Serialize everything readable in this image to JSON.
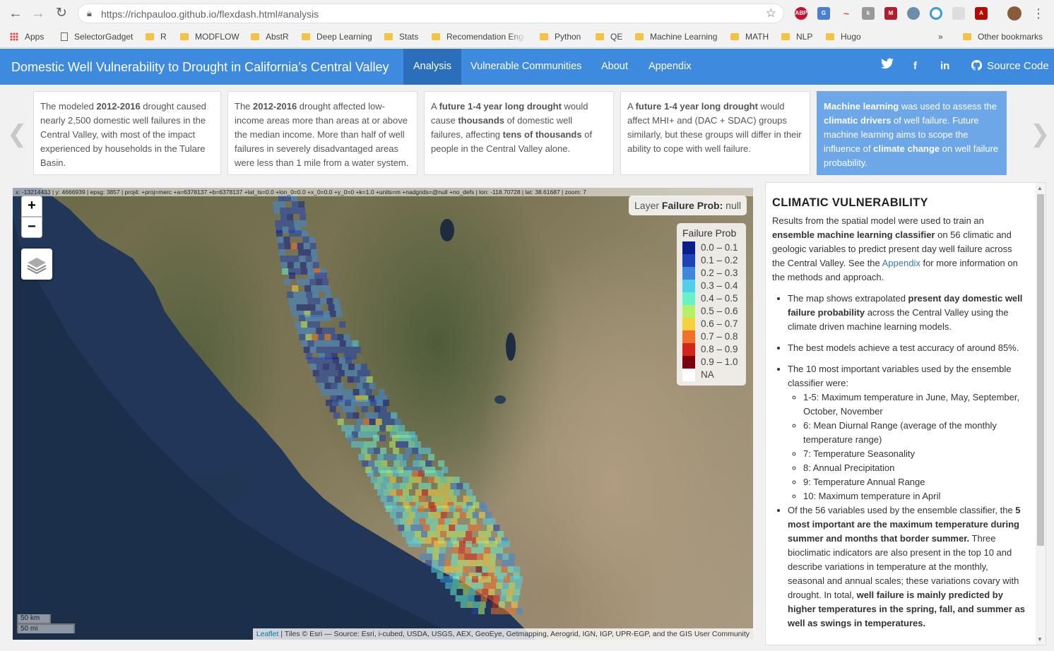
{
  "browser": {
    "url": "https://richpauloo.github.io/flexdash.html#analysis",
    "extensions": [
      "ABP",
      "G",
      "~",
      "k",
      "M",
      "",
      "",
      "",
      "A",
      ""
    ],
    "bookmarks": [
      "Apps",
      "SelectorGadget",
      "R",
      "MODFLOW",
      "AbstR",
      "Deep Learning",
      "Stats",
      "Recomendation Engi",
      "Python",
      "QE",
      "Machine Learning",
      "MATH",
      "NLP",
      "Hugo"
    ],
    "overflow": "»",
    "other_bookmarks": "Other bookmarks"
  },
  "navbar": {
    "title": "Domestic Well Vulnerability to Drought in California’s Central Valley",
    "tabs": [
      "Analysis",
      "Vulnerable Communities",
      "About",
      "Appendix"
    ],
    "active_tab": "Analysis",
    "source_code": "Source Code",
    "colors": {
      "bar": "#3e8ade",
      "active": "#2a6ebc"
    }
  },
  "valueboxes": [
    {
      "pre": "The modeled ",
      "bold": "2012-2016",
      "post": " drought caused nearly 2,500 domestic well failures in the Central Valley, with most of the impact experienced by households in the Tulare Basin."
    },
    {
      "pre": "The ",
      "bold": "2012-2016",
      "post": " drought affected low-income areas more than areas at or above the median income. More than half of well failures in severely disadvantaged areas were less than 1 mile from a water system."
    },
    {
      "p1": "A ",
      "b1": "future 1-4 year long drought",
      "p2": " would cause ",
      "b2": "thousands",
      "p3": " of domestic well failures, affecting ",
      "b3": "tens of thousands",
      "p4": " of people in the Central Valley alone."
    },
    {
      "p1": "A ",
      "b1": "future 1-4 year long drought",
      "p2": " would affect MHI+ and (DAC + SDAC) groups similarly, but these groups will differ in their ability to cope with well failure."
    },
    {
      "b1": "Machine learning",
      "p1": " was used to assess the ",
      "b2": "climatic drivers",
      "p2": " of well failure. Future machine learning aims to scope the influence of ",
      "b3": "climate change",
      "p3": " on well failure probability."
    }
  ],
  "map": {
    "coords": "x: -13214433 | y: 4666939 | epsg: 3857 | proj4: +proj=merc +a=6378137 +b=6378137 +lat_ts=0.0 +lon_0=0.0 +x_0=0.0 +y_0=0 +k=1.0 +units=m +nadgrids=@null +no_defs | lon: -118.70728 | lat: 38.61687 | zoom: 7",
    "zoom_in": "+",
    "zoom_out": "−",
    "layer_label": "Layer",
    "layer_name": "Failure Prob:",
    "layer_value": "null",
    "legend_title": "Failure Prob",
    "legend": [
      {
        "label": "0.0 – 0.1",
        "color": "#0a1e8c"
      },
      {
        "label": "0.1 – 0.2",
        "color": "#1d44b5"
      },
      {
        "label": "0.2 – 0.3",
        "color": "#3d88d8"
      },
      {
        "label": "0.3 – 0.4",
        "color": "#4fd0e8"
      },
      {
        "label": "0.4 – 0.5",
        "color": "#6cf0c8"
      },
      {
        "label": "0.5 – 0.6",
        "color": "#b6f06a"
      },
      {
        "label": "0.6 – 0.7",
        "color": "#f6d13e"
      },
      {
        "label": "0.7 – 0.8",
        "color": "#f1702a"
      },
      {
        "label": "0.8 – 0.9",
        "color": "#d42618"
      },
      {
        "label": "0.9 – 1.0",
        "color": "#7a0010"
      },
      {
        "label": "NA",
        "color": "#ffffff"
      }
    ],
    "scale_km": "50 km",
    "scale_mi": "50 mi",
    "attribution_link": "Leaflet",
    "attribution": " | Tiles © Esri — Source: Esri, i-cubed, USDA, USGS, AEX, GeoEye, Getmapping, Aerogrid, IGN, IGP, UPR-EGP, and the GIS User Community"
  },
  "panel": {
    "heading": "CLIMATIC VULNERABILITY",
    "intro": {
      "p1": "Results from the spatial model were used to train an ",
      "b1": "ensemble machine learning classifier",
      "p2": " on 56 climatic and geologic variables to predict present day well failure across the Central Valley. See the ",
      "link": "Appendix",
      "p3": " for more information on the methods and approach."
    },
    "bullet1": {
      "p1": "The map shows extrapolated ",
      "b1": "present day domestic well failure probability",
      "p2": " across the Central Valley using the climate driven machine learning models."
    },
    "bullet2": "The best models achieve a test accuracy of around 85%.",
    "bullet3": "The 10 most important variables used by the ensemble classifier were:",
    "variables": [
      "1-5: Maximum temperature in June, May, September, October, November",
      "6: Mean Diurnal Range (average of the monthly temperature range)",
      "7: Temperature Seasonality",
      "8: Annual Precipitation",
      "9: Temperature Annual Range",
      "10: Maximum temperature in April"
    ],
    "bullet4": {
      "p1": "Of the 56 variables used by the ensemble classifier, the ",
      "b1": "5 most important are the maximum temperature during summer and months that border summer.",
      "p2": " Three bioclimatic indicators are also present in the top 10 and describe variations in temperature at the monthly, seasonal and annual scales; these variations covary with drought. In total, ",
      "b2": "well failure is mainly predicted by higher temperatures in the spring, fall, and summer as well as swings in temperatures."
    }
  }
}
